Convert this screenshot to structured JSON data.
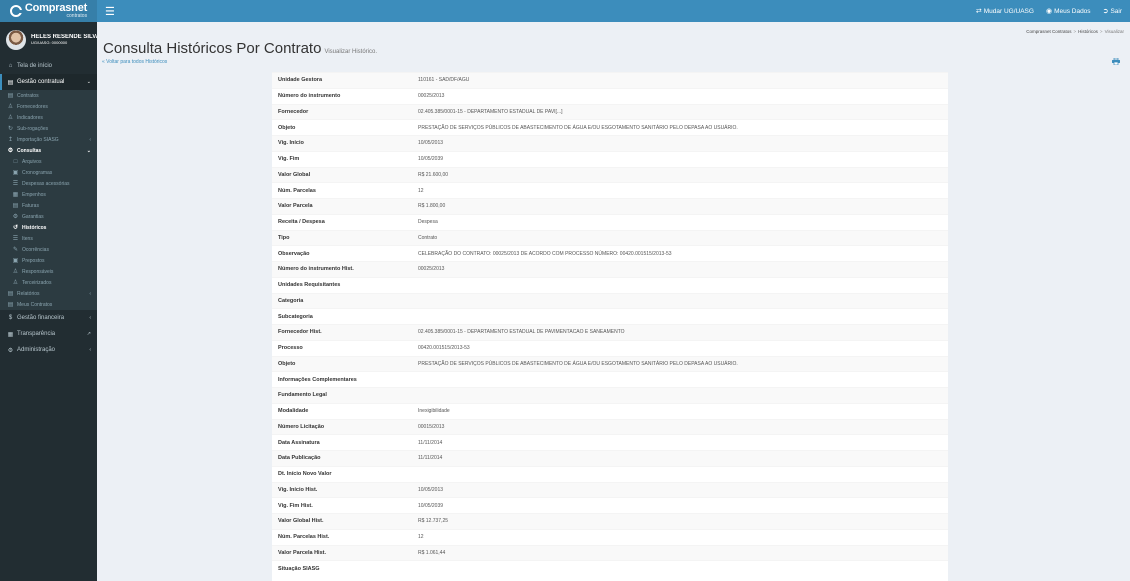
{
  "app": {
    "logo_name": "Comprasnet",
    "logo_sub": "contratos",
    "menu_toggle_icon": "hamburger-icon"
  },
  "topnav": {
    "change_unit": "Mudar UG/UASG",
    "my_data": "Meus Dados",
    "logout": "Sair"
  },
  "user": {
    "name": "HELES RESENDE SILVA...",
    "unit": "UG/UASG: 0000000"
  },
  "sidebar": {
    "home": "Tela de início",
    "contract_management": "Gestão contratual",
    "contracts": "Contratos",
    "suppliers": "Fornecedores",
    "indicators": "Indicadores",
    "sub_rogations": "Sub-rogações",
    "siasg_import": "Importação SIASG",
    "queries": "Consultas",
    "files": "Arquivos",
    "schedules": "Cronogramas",
    "accessory_expenses": "Despesas acessórias",
    "commitments": "Empenhos",
    "invoices": "Faturas",
    "guarantees": "Garantias",
    "histories": "Históricos",
    "items": "Itens",
    "occurrences": "Ocorrências",
    "agents": "Prepostos",
    "responsibles": "Responsáveis",
    "outsourced": "Terceirizados",
    "reports": "Relatórios",
    "my_contracts": "Meus Contratos",
    "financial_management": "Gestão financeira",
    "transparency": "Transparência",
    "administration": "Administração"
  },
  "page": {
    "title": "Consulta Históricos Por Contrato",
    "subtitle": "Visualizar Histórico.",
    "back_link": "« Voltar para todos Históricos",
    "breadcrumb": [
      "Comprasnet Contratos",
      "Históricos",
      "Visualizar"
    ]
  },
  "details": [
    {
      "label": "Unidade Gestora",
      "value": "110161 - SAD/DF/AGU"
    },
    {
      "label": "Número do instrumento",
      "value": "00025/2013"
    },
    {
      "label": "Fornecedor",
      "value": "02.405.385/0001-15 - DEPARTAMENTO ESTADUAL DE PAVI[...]"
    },
    {
      "label": "Objeto",
      "value": "PRESTAÇÃO DE SERVIÇOS PÚBLICOS DE ABASTECIMENTO DE ÁGUA E/OU ESGOTAMENTO SANITÁRIO PELO DEPASA AO USUÁRIO."
    },
    {
      "label": "Vig. Início",
      "value": "10/05/2013"
    },
    {
      "label": "Vig. Fim",
      "value": "10/05/2039"
    },
    {
      "label": "Valor Global",
      "value": "R$ 21.600,00"
    },
    {
      "label": "Núm. Parcelas",
      "value": "12"
    },
    {
      "label": "Valor Parcela",
      "value": "R$ 1.800,00"
    },
    {
      "label": "Receita / Despesa",
      "value": "Despesa"
    },
    {
      "label": "Tipo",
      "value": "Contrato"
    },
    {
      "label": "Observação",
      "value": "CELEBRAÇÃO DO CONTRATO: 00025/2013 DE ACORDO COM PROCESSO NÚMERO: 00420.001515/2013-53"
    },
    {
      "label": "Número do instrumento Hist.",
      "value": "00025/2013"
    },
    {
      "label": "Unidades Requisitantes",
      "value": ""
    },
    {
      "label": "Categoria",
      "value": ""
    },
    {
      "label": "Subcategoria",
      "value": ""
    },
    {
      "label": "Fornecedor Hist.",
      "value": "02.405.385/0001-15 - DEPARTAMENTO ESTADUAL DE PAVIMENTACAO E SANEAMENTO"
    },
    {
      "label": "Processo",
      "value": "00420.001515/2013-53"
    },
    {
      "label": "Objeto",
      "value": "PRESTAÇÃO DE SERVIÇOS PÚBLICOS DE ABASTECIMENTO DE ÁGUA E/OU ESGOTAMENTO SANITÁRIO PELO DEPASA AO USUÁRIO."
    },
    {
      "label": "Informações Complementares",
      "value": ""
    },
    {
      "label": "Fundamento Legal",
      "value": ""
    },
    {
      "label": "Modalidade",
      "value": "Inexigibilidade"
    },
    {
      "label": "Número Licitação",
      "value": "00015/2013"
    },
    {
      "label": "Data Assinatura",
      "value": "11/11/2014"
    },
    {
      "label": "Data Publicação",
      "value": "11/11/2014"
    },
    {
      "label": "Dt. Início Novo Valor",
      "value": ""
    },
    {
      "label": "Vig. Início Hist.",
      "value": "10/05/2013"
    },
    {
      "label": "Vig. Fim Hist.",
      "value": "10/05/2039"
    },
    {
      "label": "Valor Global Hist.",
      "value": "R$ 12.737,25"
    },
    {
      "label": "Núm. Parcelas Hist.",
      "value": "12"
    },
    {
      "label": "Valor Parcela Hist.",
      "value": "R$ 1.061,44"
    },
    {
      "label": "Situação SIASG",
      "value": ""
    }
  ]
}
